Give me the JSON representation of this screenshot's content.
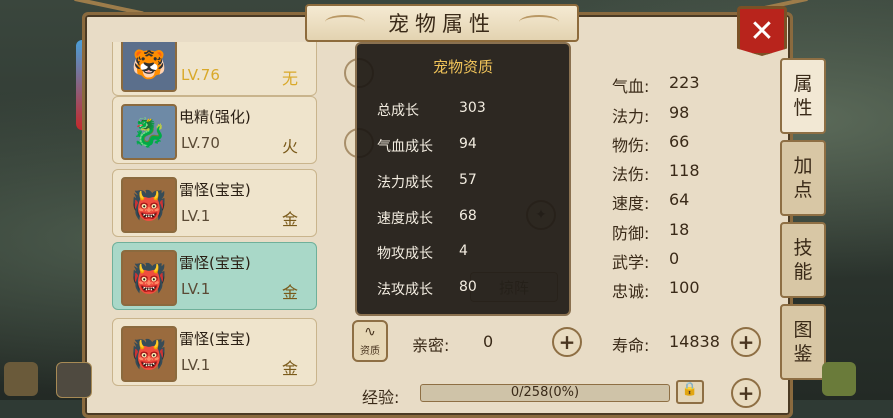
{
  "window": {
    "title": "宠物属性",
    "close_label": "✕"
  },
  "pets": [
    {
      "name": "",
      "level": "LV.76",
      "element": "无",
      "avatar": "🐯",
      "selected": false
    },
    {
      "name": "电精(强化)",
      "level": "LV.70",
      "element": "火",
      "avatar": "🐉",
      "selected": false
    },
    {
      "name": "雷怪(宝宝)",
      "level": "LV.1",
      "element": "金",
      "avatar": "👹",
      "selected": false
    },
    {
      "name": "雷怪(宝宝)",
      "level": "LV.1",
      "element": "金",
      "avatar": "👹",
      "selected": true
    },
    {
      "name": "雷怪(宝宝)",
      "level": "LV.1",
      "element": "金",
      "avatar": "👹",
      "selected": false
    }
  ],
  "tabs": [
    {
      "label": "属\n性",
      "active": true
    },
    {
      "label": "加\n点",
      "active": false
    },
    {
      "label": "技\n能",
      "active": false
    },
    {
      "label": "图\n鉴",
      "active": false
    }
  ],
  "stats": [
    {
      "label": "气血:",
      "value": "223"
    },
    {
      "label": "法力:",
      "value": "98"
    },
    {
      "label": "物伤:",
      "value": "66"
    },
    {
      "label": "法伤:",
      "value": "118"
    },
    {
      "label": "速度:",
      "value": "64"
    },
    {
      "label": "防御:",
      "value": "18"
    },
    {
      "label": "武学:",
      "value": "0"
    },
    {
      "label": "忠诚:",
      "value": "100"
    }
  ],
  "aptitude_popup": {
    "title": "宠物资质",
    "rows": [
      {
        "label": "总成长",
        "value": "303"
      },
      {
        "label": "气血成长",
        "value": "94"
      },
      {
        "label": "法力成长",
        "value": "57"
      },
      {
        "label": "速度成长",
        "value": "68"
      },
      {
        "label": "物攻成长",
        "value": "4"
      },
      {
        "label": "法攻成长",
        "value": "80"
      }
    ]
  },
  "bottom": {
    "aptitude_button_label": "资质",
    "intimacy_label": "亲密:",
    "intimacy_value": "0",
    "lifespan_label": "寿命:",
    "lifespan_value": "14838",
    "exp_label": "经验:",
    "exp_text": "0/258(0%)",
    "exp_fraction": 0,
    "formation_label": "掠阵",
    "plus": "+"
  },
  "colors": {
    "accent": "#b8241c",
    "selected_row": "#a9d8c8",
    "popup_title": "#f2c55a"
  }
}
